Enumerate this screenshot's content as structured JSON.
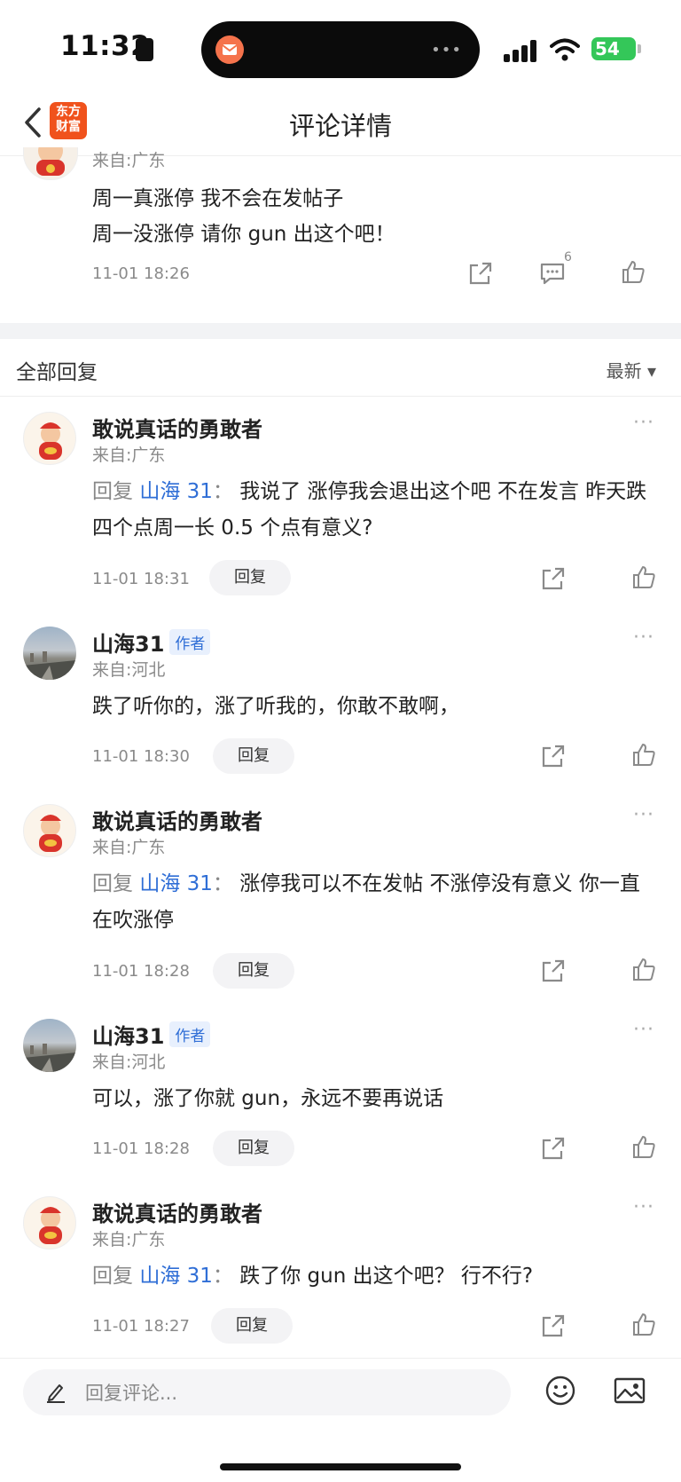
{
  "status_bar": {
    "time": "11:32",
    "battery": "54"
  },
  "nav": {
    "title": "评论详情",
    "logo_line1": "东方",
    "logo_line2": "财富"
  },
  "top_post": {
    "from": "来自:广东",
    "line1": "周一真涨停 我不会在发帖子",
    "line2": "周一没涨停 请你 gun 出这个吧！",
    "date": "11-01 18:26",
    "comment_count": "6"
  },
  "section": {
    "title": "全部回复",
    "sort": "最新 ▾"
  },
  "comments": [
    {
      "name": "敢说真话的勇敢者",
      "from": "来自:广东",
      "reply_prefix": "回复 ",
      "reply_to": "山海 31",
      "sep": "： ",
      "text": "我说了 涨停我会退出这个吧 不在发言 昨天跌四个点周一长 0.5 个点有意义?",
      "date": "11-01 18:31",
      "reply_label": "回复",
      "more": "···"
    },
    {
      "name": "山海31",
      "badge": "作者",
      "from": "来自:河北",
      "text": "跌了听你的，涨了听我的，你敢不敢啊，",
      "date": "11-01 18:30",
      "reply_label": "回复",
      "more": "···"
    },
    {
      "name": "敢说真话的勇敢者",
      "from": "来自:广东",
      "reply_prefix": "回复 ",
      "reply_to": "山海 31",
      "sep": "： ",
      "text": "涨停我可以不在发帖  不涨停没有意义 你一直在吹涨停",
      "date": "11-01 18:28",
      "reply_label": "回复",
      "more": "···"
    },
    {
      "name": "山海31",
      "badge": "作者",
      "from": "来自:河北",
      "text": "可以，涨了你就 gun，永远不要再说话",
      "date": "11-01 18:28",
      "reply_label": "回复",
      "more": "···"
    },
    {
      "name": "敢说真话的勇敢者",
      "from": "来自:广东",
      "reply_prefix": "回复 ",
      "reply_to": "山海 31",
      "sep": "： ",
      "text": "跌了你 gun 出这个吧？ 行不行?",
      "date": "11-01 18:27",
      "reply_label": "回复",
      "more": "···"
    }
  ],
  "bottom": {
    "placeholder": "回复评论..."
  }
}
